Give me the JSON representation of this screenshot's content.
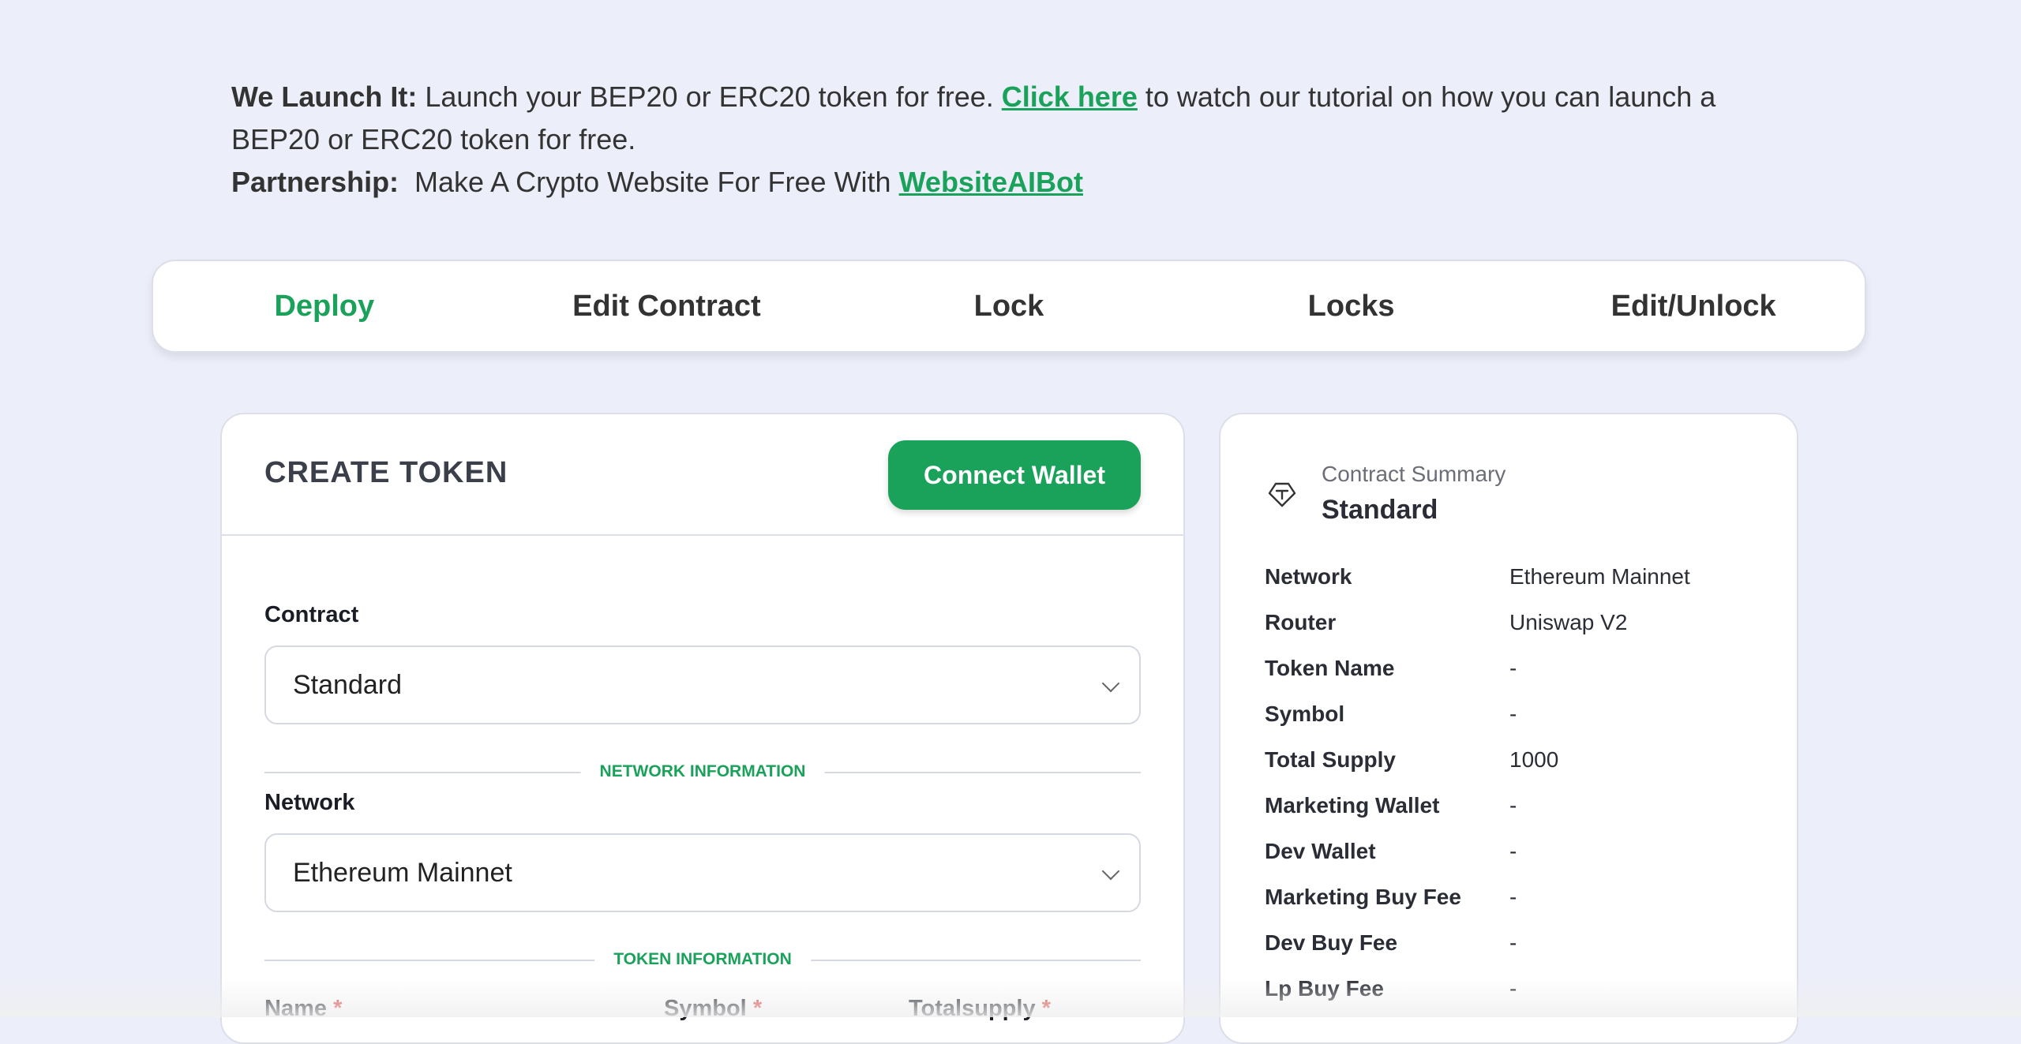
{
  "banner": {
    "line1_bold": "We Launch It:",
    "line1_text_a": " Launch your BEP20 or ERC20 token for free. ",
    "line1_link": "Click here",
    "line1_text_b": " to watch our tutorial on how you can launch a BEP20 or ERC20 token for free.",
    "line2_bold": "Partnership:",
    "line2_text": "  Make A Crypto Website For Free With ",
    "line2_link": "WebsiteAIBot"
  },
  "tabs": [
    "Deploy",
    "Edit Contract",
    "Lock",
    "Locks",
    "Edit/Unlock"
  ],
  "create": {
    "title": "CREATE TOKEN",
    "connect_label": "Connect Wallet",
    "contract_label": "Contract",
    "contract_value": "Standard",
    "network_section": "NETWORK INFORMATION",
    "network_label": "Network",
    "network_value": "Ethereum Mainnet",
    "token_section": "TOKEN INFORMATION",
    "name_label": "Name",
    "symbol_label": "Symbol",
    "totalsupply_label": "Totalsupply",
    "required_mark": "*"
  },
  "summary": {
    "subtitle": "Contract Summary",
    "title": "Standard",
    "rows": [
      {
        "k": "Network",
        "v": "Ethereum Mainnet"
      },
      {
        "k": "Router",
        "v": "Uniswap V2"
      },
      {
        "k": "Token Name",
        "v": "-"
      },
      {
        "k": "Symbol",
        "v": "-"
      },
      {
        "k": "Total Supply",
        "v": "1000"
      },
      {
        "k": "Marketing Wallet",
        "v": "-"
      },
      {
        "k": "Dev Wallet",
        "v": "-"
      },
      {
        "k": "Marketing Buy Fee",
        "v": "-"
      },
      {
        "k": "Dev Buy Fee",
        "v": "-"
      },
      {
        "k": "Lp Buy Fee",
        "v": "-"
      }
    ]
  },
  "colors": {
    "accent": "#1aa15a",
    "background": "#eceef9",
    "required": "#d9302c"
  }
}
